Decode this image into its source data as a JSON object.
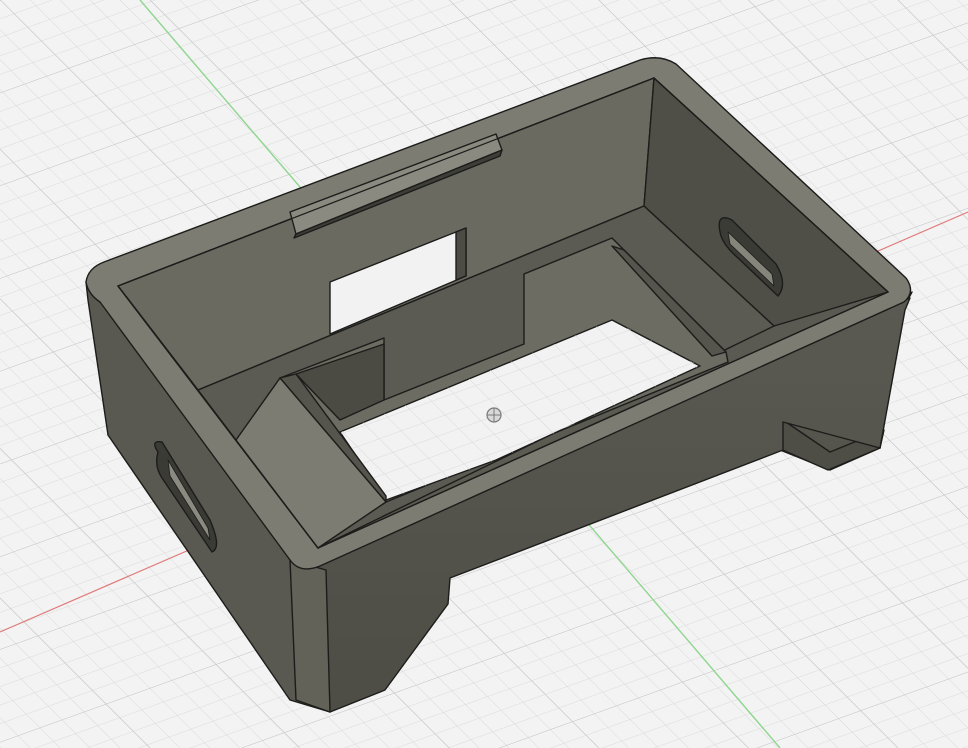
{
  "viewport": {
    "background": "#f3f3f3",
    "grid_minor_color": "#d6d6d6",
    "grid_major_color": "#c2c2c2",
    "x_axis_color": "#e07a7a",
    "y_axis_color": "#8fd68f",
    "origin_icon": "origin-marker-icon"
  },
  "model": {
    "name": "enclosure-box",
    "body_color": "#5f5f56",
    "top_face_color": "#7a7a70",
    "inner_shadow_color": "#4a4a43",
    "edge_color": "#1c1c1a"
  }
}
